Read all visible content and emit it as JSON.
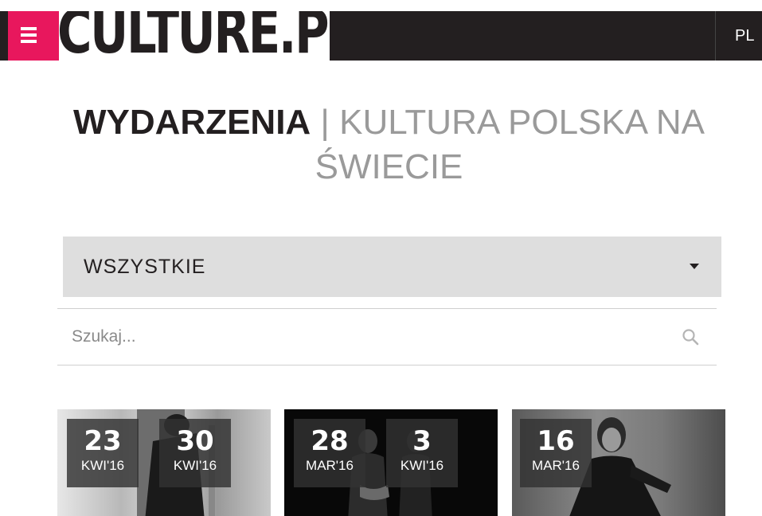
{
  "header": {
    "logo_text": "CULTURE.PL",
    "language": "PL",
    "menu_icon": "hamburger-menu-icon",
    "accent_color": "#e8175d"
  },
  "title": {
    "main": "WYDARZENIA",
    "separator": "|",
    "sub": "KULTURA POLSKA NA ŚWIECIE"
  },
  "filter": {
    "selected": "WSZYSTKIE"
  },
  "search": {
    "placeholder": "Szukaj...",
    "icon": "search-icon"
  },
  "events": [
    {
      "dates": [
        {
          "day": "23",
          "month": "KWI'16"
        },
        {
          "day": "30",
          "month": "KWI'16"
        }
      ]
    },
    {
      "dates": [
        {
          "day": "28",
          "month": "MAR'16"
        },
        {
          "day": "3",
          "month": "KWI'16"
        }
      ]
    },
    {
      "dates": [
        {
          "day": "16",
          "month": "MAR'16"
        }
      ]
    }
  ]
}
